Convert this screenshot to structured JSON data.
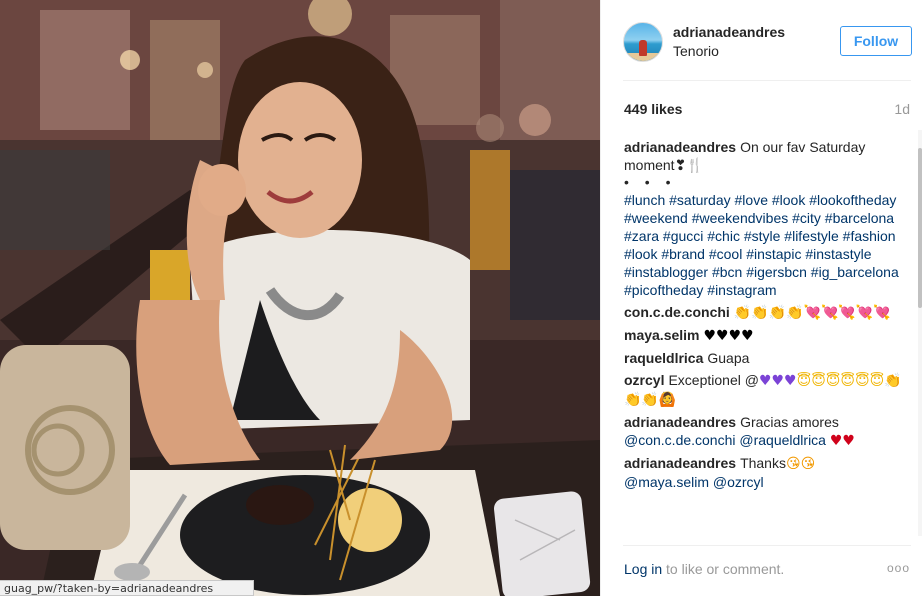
{
  "photo": {
    "description_icon": "photo",
    "url_tooltip": "guag_pw/?taken-by=adrianadeandres"
  },
  "header": {
    "username": "adrianadeandres",
    "location": "Tenorio",
    "follow_label": "Follow"
  },
  "stats": {
    "likes": "449 likes",
    "age": "1d"
  },
  "caption": {
    "user": "adrianadeandres",
    "text": "On our fav Saturday moment",
    "text_emoji": "❣🍴",
    "dots": "• • •",
    "hashtags": "#lunch #saturday #love #look #lookoftheday #weekend #weekendvibes #city #barcelona #zara #gucci #chic #style #lifestyle #fashion #look #brand #cool #instapic #instastyle #instablogger #bcn #igersbcn #ig_barcelona #picoftheday #instagram"
  },
  "comments": [
    {
      "user": "con.c.de.conchi",
      "text": "",
      "emoji_hands": "👏👏👏👏",
      "emoji_hearts": "💘💘💘💘💘"
    },
    {
      "user": "maya.selim",
      "text": "",
      "emoji_black": "♥♥♥♥"
    },
    {
      "user": "raqueldlrica",
      "text": "Guapa"
    },
    {
      "user": "ozrcyl",
      "text": "Exceptionel @",
      "emoji_purple": "♥♥♥",
      "emoji_smile": "😇😇😇😇😇😇",
      "emoji_hands": "👏👏👏🙆"
    },
    {
      "user": "adrianadeandres",
      "text": "Gracias amores",
      "mentions": "@con.c.de.conchi @raqueldlrica",
      "emoji_hearts": "♥♥"
    },
    {
      "user": "adrianadeandres",
      "text": "Thanks",
      "emoji_kiss": "😘😘",
      "mentions": "@maya.selim @ozrcyl"
    }
  ],
  "footer": {
    "login_link": "Log in",
    "login_rest": " to like or comment.",
    "more_icon": "ooo"
  },
  "colors": {
    "link": "#003569",
    "follow": "#3897f0",
    "muted": "#999999"
  }
}
